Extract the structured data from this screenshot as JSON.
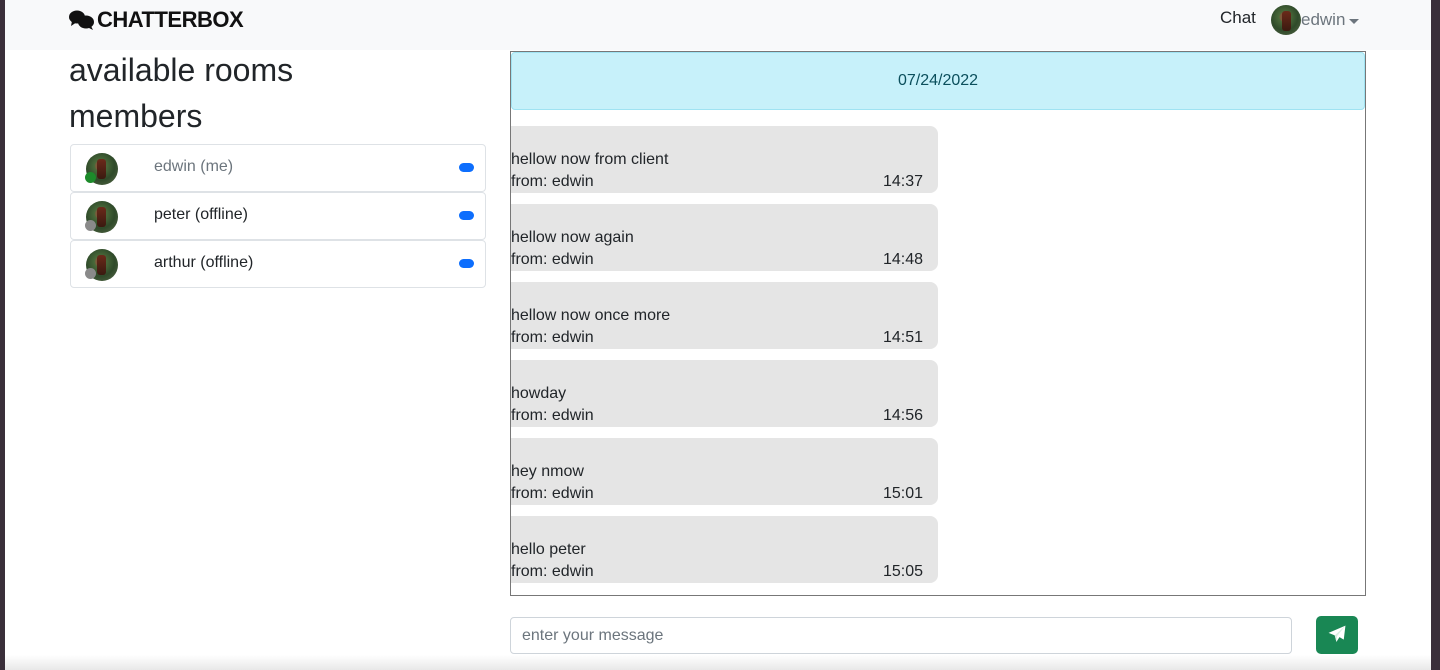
{
  "navbar": {
    "brand": "CHATTERBOX",
    "chat_link": "Chat",
    "user_name": "edwin"
  },
  "sidebar": {
    "rooms_heading": "available rooms",
    "members_heading": "members",
    "members": [
      {
        "name": "edwin (me)",
        "status": "online"
      },
      {
        "name": "peter (offline)",
        "status": "offline"
      },
      {
        "name": "arthur (offline)",
        "status": "offline"
      }
    ]
  },
  "chat": {
    "date": "07/24/2022",
    "messages": [
      {
        "text": "hellow now from client",
        "from": "from: edwin",
        "time": "14:37"
      },
      {
        "text": "hellow now again",
        "from": "from: edwin",
        "time": "14:48"
      },
      {
        "text": "hellow now once more",
        "from": "from: edwin",
        "time": "14:51"
      },
      {
        "text": "howday",
        "from": "from: edwin",
        "time": "14:56"
      },
      {
        "text": "hey nmow",
        "from": "from: edwin",
        "time": "15:01"
      },
      {
        "text": "hello peter",
        "from": "from: edwin",
        "time": "15:05"
      }
    ]
  },
  "composer": {
    "placeholder": "enter your message",
    "value": ""
  },
  "colors": {
    "online": "#1c8a2a",
    "offline": "#8a8a8a",
    "badge": "#0d6efd",
    "send_button": "#198754",
    "date_bar": "#c7f1fa"
  },
  "icons": {
    "brand": "chat-bubbles-icon",
    "send": "paper-plane-icon"
  }
}
